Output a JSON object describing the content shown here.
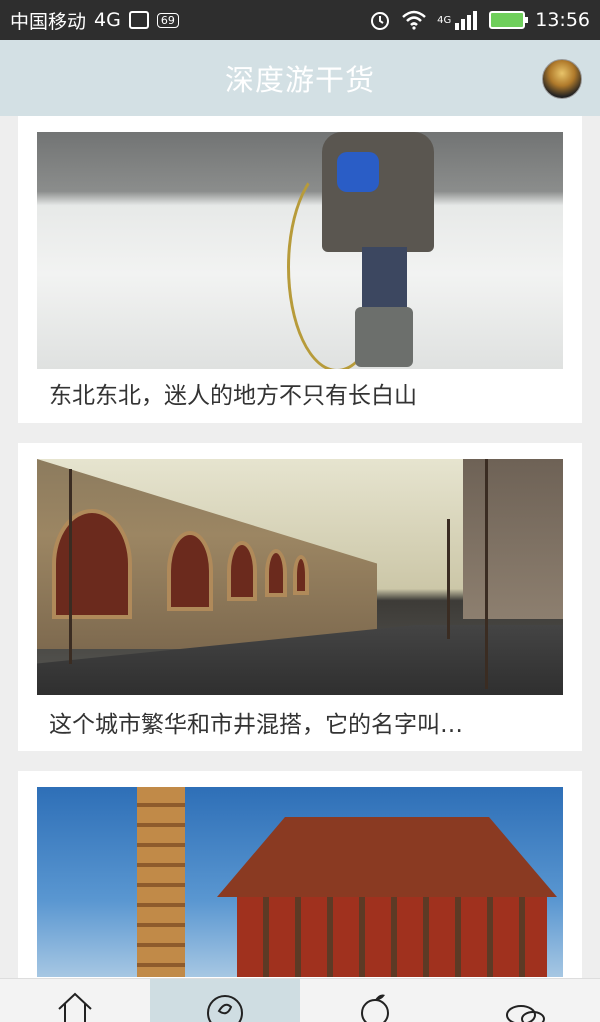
{
  "status_bar": {
    "carrier": "中国移动",
    "network": "4G",
    "badge": "69",
    "signal_label": "4G",
    "time": "13:56",
    "icons": [
      "image-icon",
      "alarm-icon",
      "wifi-icon",
      "signal-icon",
      "battery-icon"
    ]
  },
  "header": {
    "title": "深度游干货",
    "avatar_icon": "avatar-icon"
  },
  "feed": {
    "articles": [
      {
        "title": "东北东北，迷人的地方不只有长白山"
      },
      {
        "title": "这个城市繁华和市井混搭，它的名字叫…"
      },
      {
        "title": ""
      }
    ]
  },
  "tab_bar": {
    "tabs": [
      {
        "icon": "home-icon",
        "active": false
      },
      {
        "icon": "compass-icon",
        "active": true
      },
      {
        "icon": "fruit-icon",
        "active": false
      },
      {
        "icon": "chat-icon",
        "active": false
      }
    ]
  },
  "colors": {
    "status_bar_bg": "#2e2e2e",
    "header_bg": "#d3e0e4",
    "page_bg": "#eeeeee",
    "active_tab_bg": "#cfdde2",
    "battery_green": "#6fcf5b"
  }
}
